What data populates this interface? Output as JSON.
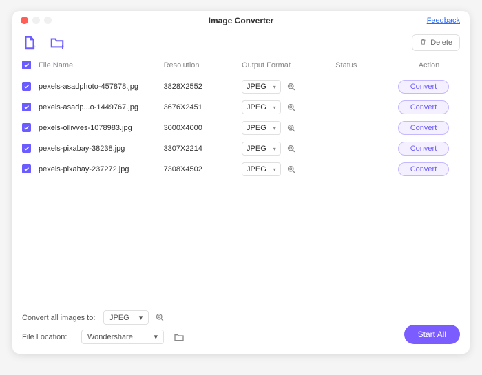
{
  "window": {
    "title": "Image Converter",
    "feedback": "Feedback"
  },
  "toolbar": {
    "delete_label": "Delete"
  },
  "icons": {
    "add_file": "add-file-icon",
    "add_folder": "add-folder-icon",
    "delete": "trash-icon",
    "settings": "settings-search-icon",
    "folder": "folder-open-icon",
    "caret": "chevron-down-icon",
    "check": "check-icon"
  },
  "table": {
    "headers": {
      "filename": "File Name",
      "resolution": "Resolution",
      "format": "Output Format",
      "status": "Status",
      "action": "Action"
    },
    "rows": [
      {
        "checked": true,
        "filename": "pexels-asadphoto-457878.jpg",
        "resolution": "3828X2552",
        "format": "JPEG",
        "status": "",
        "action": "Convert"
      },
      {
        "checked": true,
        "filename": "pexels-asadp...o-1449767.jpg",
        "resolution": "3676X2451",
        "format": "JPEG",
        "status": "",
        "action": "Convert"
      },
      {
        "checked": true,
        "filename": "pexels-ollivves-1078983.jpg",
        "resolution": "3000X4000",
        "format": "JPEG",
        "status": "",
        "action": "Convert"
      },
      {
        "checked": true,
        "filename": "pexels-pixabay-38238.jpg",
        "resolution": "3307X2214",
        "format": "JPEG",
        "status": "",
        "action": "Convert"
      },
      {
        "checked": true,
        "filename": "pexels-pixabay-237272.jpg",
        "resolution": "7308X4502",
        "format": "JPEG",
        "status": "",
        "action": "Convert"
      }
    ]
  },
  "footer": {
    "convert_all_label": "Convert all images to:",
    "convert_all_value": "JPEG",
    "location_label": "File Location:",
    "location_value": "Wondershare",
    "start_all": "Start  All"
  },
  "colors": {
    "accent": "#7a5cff",
    "accent_light": "#f4f0ff",
    "link": "#2b6cff"
  }
}
